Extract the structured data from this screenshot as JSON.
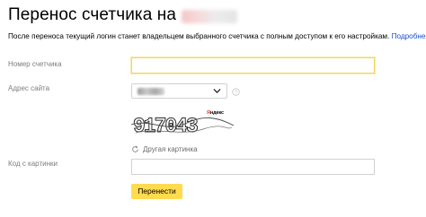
{
  "header": {
    "title": "Перенос счетчика на",
    "title_site_value": "hidden (blurred)"
  },
  "info": {
    "text": "После переноса текущий логин станет владельцем выбранного счетчика с полным доступом к его настройкам.",
    "more_link": "Подробнее"
  },
  "form": {
    "counter_number": {
      "label": "Номер счетчика",
      "value": "",
      "state": "focused"
    },
    "site_address": {
      "label": "Адрес сайта",
      "value": "hidden (blurred)"
    },
    "captcha": {
      "image_text": "917043",
      "brand_prefix": "Я",
      "brand_rest": "ндекс",
      "refresh_label": "Другая картинка"
    },
    "captcha_code": {
      "label": "Код с картинки",
      "value": ""
    },
    "submit_label": "Перенести"
  },
  "colors": {
    "accent_button": "#ffdb4d",
    "focus_border": "#f1d760",
    "link": "#1a4fd1",
    "label": "#7d7d7d",
    "brand_red": "#e03a2f"
  },
  "icons": {
    "select_chevron": "chevron-down-icon",
    "help": "question-circle-icon",
    "refresh": "refresh-icon"
  }
}
